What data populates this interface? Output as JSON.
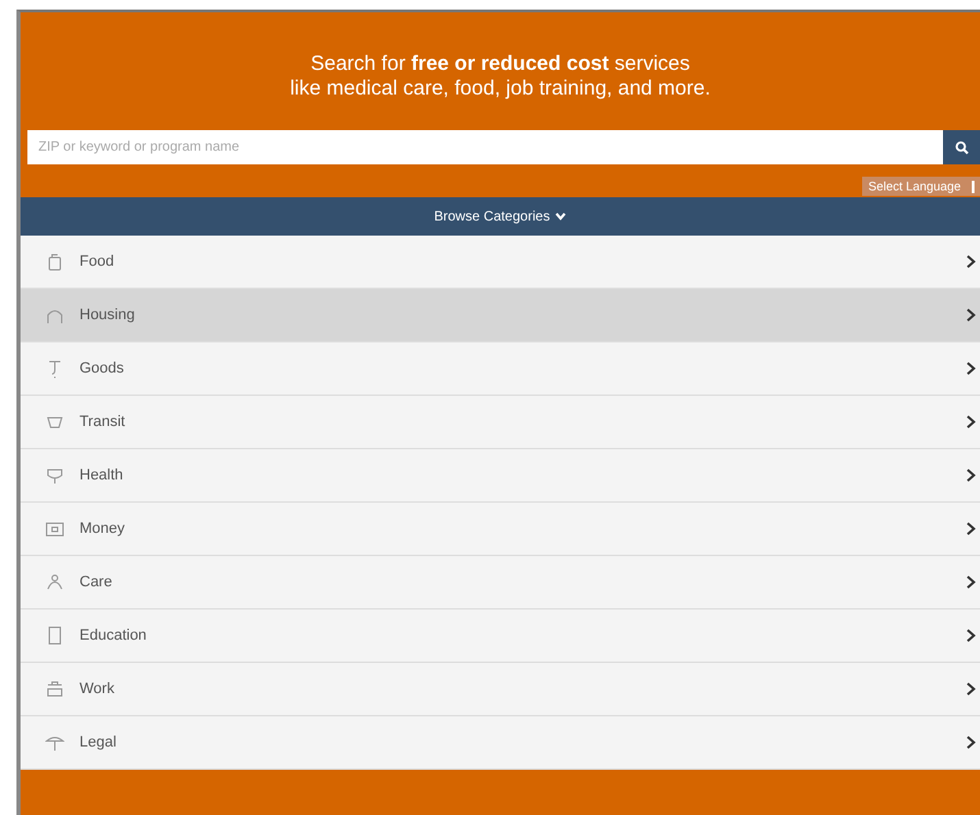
{
  "header": {
    "tagline": [
      "Search for **free or reduced cost** services",
      "like medical care, food, job training, and more."
    ]
  },
  "search": {
    "placeholder": "ZIP or keyword or program name"
  },
  "language": {
    "label": "Select Language"
  },
  "browse": {
    "label": "Browse Categories"
  },
  "categories": [
    {
      "label": "Food",
      "kind": "food",
      "selected": false
    },
    {
      "label": "Housing",
      "kind": "housing",
      "selected": true
    },
    {
      "label": "Goods",
      "kind": "goods",
      "selected": false
    },
    {
      "label": "Transit",
      "kind": "transit",
      "selected": false
    },
    {
      "label": "Health",
      "kind": "health",
      "selected": false
    },
    {
      "label": "Money",
      "kind": "money",
      "selected": false
    },
    {
      "label": "Care",
      "kind": "care",
      "selected": false
    },
    {
      "label": "Education",
      "kind": "education",
      "selected": false
    },
    {
      "label": "Work",
      "kind": "work",
      "selected": false
    },
    {
      "label": "Legal",
      "kind": "legal",
      "selected": false
    }
  ]
}
